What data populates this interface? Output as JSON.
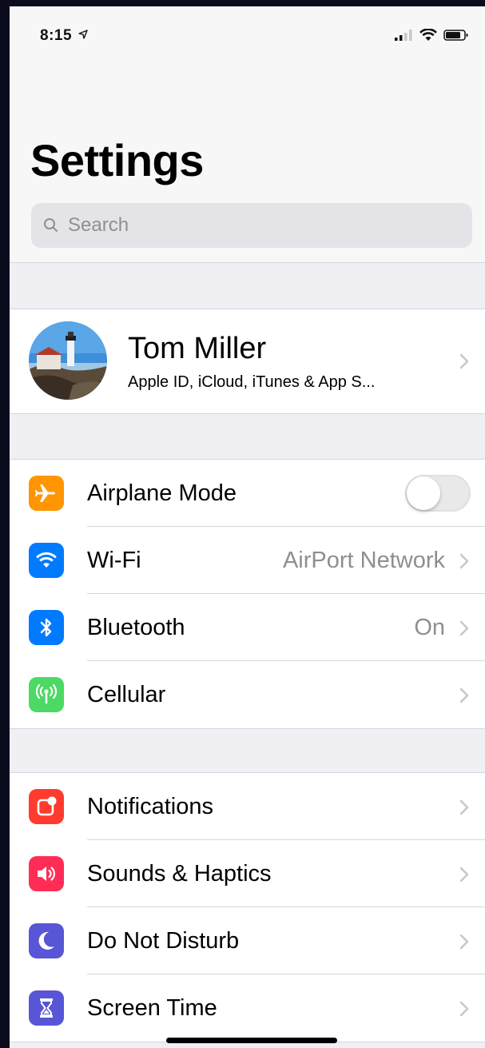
{
  "status_bar": {
    "time": "8:15",
    "location_icon": "location-arrow-icon",
    "signal_icon": "cellular-signal-icon",
    "wifi_icon": "wifi-icon",
    "battery_icon": "battery-icon"
  },
  "header": {
    "title": "Settings",
    "search_placeholder": "Search"
  },
  "profile": {
    "name": "Tom Miller",
    "subtitle": "Apple ID, iCloud, iTunes & App S..."
  },
  "group_connectivity": [
    {
      "label": "Airplane Mode",
      "icon": "airplane-icon",
      "color": "#ff9500",
      "toggle_on": false
    },
    {
      "label": "Wi-Fi",
      "icon": "wifi-icon",
      "color": "#007aff",
      "value": "AirPort Network"
    },
    {
      "label": "Bluetooth",
      "icon": "bluetooth-icon",
      "color": "#007aff",
      "value": "On"
    },
    {
      "label": "Cellular",
      "icon": "cellular-antenna-icon",
      "color": "#4cd964"
    }
  ],
  "group_notifications": [
    {
      "label": "Notifications",
      "icon": "notifications-icon",
      "color": "#ff3b30"
    },
    {
      "label": "Sounds & Haptics",
      "icon": "speaker-icon",
      "color": "#ff2d55"
    },
    {
      "label": "Do Not Disturb",
      "icon": "moon-icon",
      "color": "#5856d6"
    },
    {
      "label": "Screen Time",
      "icon": "hourglass-icon",
      "color": "#5856d6"
    }
  ]
}
